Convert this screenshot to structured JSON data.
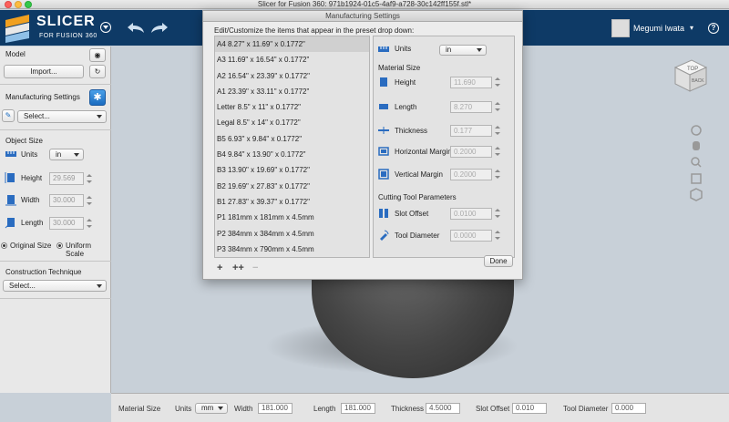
{
  "window": {
    "title": "Slicer for Fusion 360: 971b1924-01c5-4af9-a728-30c142ff155f.stl*"
  },
  "app": {
    "logo_title": "SLICER",
    "logo_subtitle": "FOR FUSION 360",
    "user_name": "Megumi Iwata",
    "help_label": "?"
  },
  "left_panel": {
    "model_label": "Model",
    "import_label": "Import...",
    "manufacturing_label": "Manufacturing Settings",
    "manufacturing_select": "Select...",
    "object_size_label": "Object Size",
    "units_label": "Units",
    "units_value": "in",
    "height_label": "Height",
    "height_value": "29.569",
    "width_label": "Width",
    "width_value": "30.000",
    "length_label": "Length",
    "length_value": "30.000",
    "original_size_label": "Original Size",
    "uniform_scale_label": "Uniform Scale",
    "construction_label": "Construction Technique",
    "construction_select": "Select..."
  },
  "bottom_bar": {
    "material_size_label": "Material Size",
    "units_label": "Units",
    "units_value": "mm",
    "width_label": "Width",
    "width_value": "181.000",
    "length_label": "Length",
    "length_value": "181.000",
    "thickness_label": "Thickness",
    "thickness_value": "4.5000",
    "slot_offset_label": "Slot Offset",
    "slot_offset_value": "0.010",
    "tool_diameter_label": "Tool Diameter",
    "tool_diameter_value": "0.000"
  },
  "dialog": {
    "title": "Manufacturing Settings",
    "instructions": "Edit/Customize the items that appear in the preset drop down:",
    "presets": [
      "A4 8.27\" x 11.69\" x 0.1772\"",
      "A3 11.69\" x 16.54\" x 0.1772\"",
      "A2 16.54\" x 23.39\" x 0.1772\"",
      "A1 23.39\" x 33.11\" x 0.1772\"",
      "Letter 8.5\" x 11\" x 0.1772\"",
      "Legal 8.5\" x 14\" x 0.1772\"",
      "B5 6.93\" x 9.84\" x 0.1772\"",
      "B4 9.84\" x 13.90\" x 0.1772\"",
      "B3 13.90\" x 19.69\" x 0.1772\"",
      "B2 19.69\" x 27.83\" x 0.1772\"",
      "B1 27.83\" x 39.37\" x 0.1772\"",
      "P1 181mm x 181mm x 4.5mm",
      "P2 384mm x 384mm x 4.5mm",
      "P3 384mm x 790mm x 4.5mm"
    ],
    "units_label": "Units",
    "units_value": "in",
    "material_size_label": "Material Size",
    "height_label": "Height",
    "height_value": "11.690",
    "length_label": "Length",
    "length_value": "8.270",
    "thickness_label": "Thickness",
    "thickness_value": "0.177",
    "horizontal_margin_label": "Horizontal Margin",
    "horizontal_margin_value": "0.2000",
    "vertical_margin_label": "Vertical Margin",
    "vertical_margin_value": "0.2000",
    "cutting_params_label": "Cutting Tool Parameters",
    "slot_offset_label": "Slot  Offset",
    "slot_offset_value": "0.0100",
    "tool_diameter_label": "Tool Diameter",
    "tool_diameter_value": "0.0000",
    "add_label": "+",
    "duplicate_label": "++",
    "remove_label": "−",
    "done_label": "Done"
  },
  "viewcube": {
    "top_label": "TOP",
    "back_label": "BACK"
  }
}
